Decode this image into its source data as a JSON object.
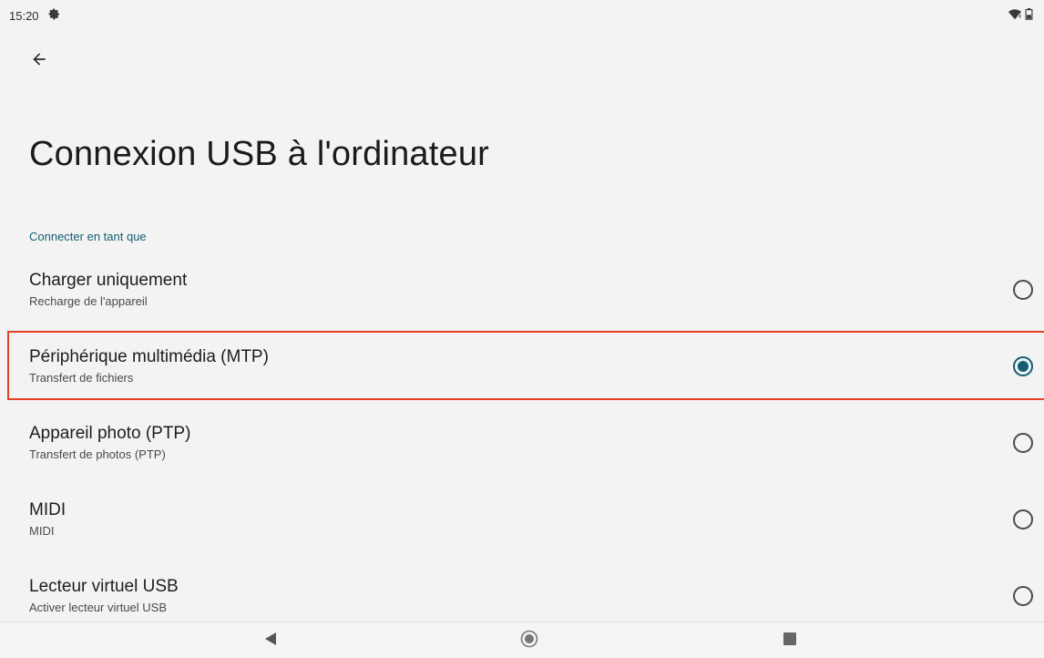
{
  "status_bar": {
    "time": "15:20",
    "icons": [
      "settings-gear-icon",
      "wifi-icon",
      "battery-icon"
    ]
  },
  "header": {
    "back_icon": "arrow-left-icon",
    "title": "Connexion USB à l'ordinateur"
  },
  "section": {
    "label": "Connecter en tant que"
  },
  "options": [
    {
      "title": "Charger uniquement",
      "subtitle": "Recharge de l'appareil",
      "selected": false
    },
    {
      "title": "Périphérique multimédia (MTP)",
      "subtitle": "Transfert de fichiers",
      "selected": true
    },
    {
      "title": "Appareil photo (PTP)",
      "subtitle": "Transfert de photos (PTP)",
      "selected": false
    },
    {
      "title": "MIDI",
      "subtitle": "MIDI",
      "selected": false
    },
    {
      "title": "Lecteur virtuel USB",
      "subtitle": "Activer lecteur virtuel USB",
      "selected": false
    }
  ],
  "nav_bar": {
    "buttons": [
      "back-triangle-icon",
      "home-circle-icon",
      "recents-square-icon"
    ]
  },
  "colors": {
    "accent": "#135e72",
    "highlight_border": "#e5402a",
    "background": "#f3f3f3"
  }
}
